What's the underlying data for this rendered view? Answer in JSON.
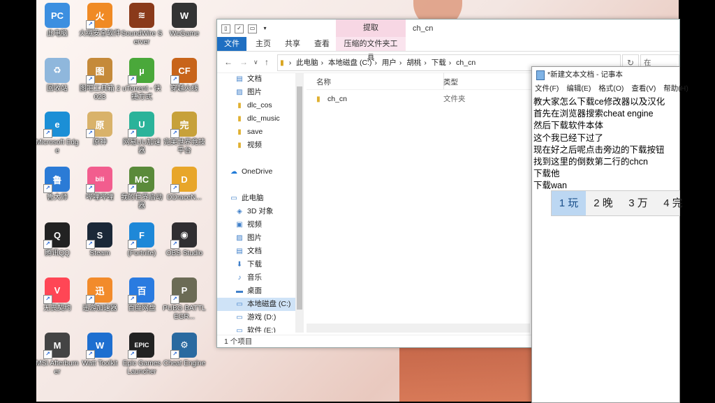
{
  "desktop": {
    "col1": [
      {
        "label": "此电脑",
        "color": "#3c8fe0",
        "glyph": "PC",
        "shortcut": false
      },
      {
        "label": "回收站",
        "color": "#8fb7dc",
        "glyph": "♻",
        "shortcut": false
      },
      {
        "label": "Microsoft Edge",
        "color": "#1b8fd6",
        "glyph": "e",
        "shortcut": true
      },
      {
        "label": "鲁大师",
        "color": "#2b7bd6",
        "glyph": "鲁",
        "shortcut": true
      },
      {
        "label": "腾讯QQ",
        "color": "#222",
        "glyph": "Q",
        "shortcut": true
      },
      {
        "label": "无畏契约",
        "color": "#ff4655",
        "glyph": "V",
        "shortcut": true
      },
      {
        "label": "MSI Afterburner",
        "color": "#444",
        "glyph": "M",
        "shortcut": true
      }
    ],
    "col2": [
      {
        "label": "火绒安全软件",
        "color": "#f08a24",
        "glyph": "火",
        "shortcut": true
      },
      {
        "label": "图吧工具箱 2023",
        "color": "#c58a3a",
        "glyph": "图",
        "shortcut": true
      },
      {
        "label": "原神",
        "color": "#d9b26a",
        "glyph": "原",
        "shortcut": true
      },
      {
        "label": "哔哩哔哩",
        "color": "#f25d8e",
        "glyph": "bili",
        "shortcut": true
      },
      {
        "label": "Steam",
        "color": "#1b2838",
        "glyph": "S",
        "shortcut": true
      },
      {
        "label": "迅游加速器",
        "color": "#f28b2b",
        "glyph": "迅",
        "shortcut": true
      },
      {
        "label": "Watt Toolkit",
        "color": "#1e6fd0",
        "glyph": "W",
        "shortcut": true
      }
    ],
    "col3": [
      {
        "label": "SoundWire Server",
        "color": "#8a3a1a",
        "glyph": "≋",
        "shortcut": false
      },
      {
        "label": "uTorrent - 快捷方式",
        "color": "#4aa83a",
        "glyph": "µ",
        "shortcut": true
      },
      {
        "label": "网易UU加速器",
        "color": "#2bb39a",
        "glyph": "U",
        "shortcut": true
      },
      {
        "label": "我的世界启动器",
        "color": "#5a8a3a",
        "glyph": "MC",
        "shortcut": true
      },
      {
        "label": "(Fortnite)",
        "color": "#1e88d8",
        "glyph": "F",
        "shortcut": true
      },
      {
        "label": "百度网盘",
        "color": "#2a7be0",
        "glyph": "百",
        "shortcut": true
      },
      {
        "label": "Epic Games Launcher",
        "color": "#222",
        "glyph": "EPIC",
        "shortcut": true
      }
    ],
    "col4": [
      {
        "label": "WeGame",
        "color": "#333",
        "glyph": "W",
        "shortcut": false
      },
      {
        "label": "穿越火线",
        "color": "#c8641a",
        "glyph": "CF",
        "shortcut": true
      },
      {
        "label": "完美世界竞技平台",
        "color": "#c7a13a",
        "glyph": "完",
        "shortcut": true
      },
      {
        "label": "DDraceN...",
        "color": "#e8a62a",
        "glyph": "D",
        "shortcut": true
      },
      {
        "label": "OBS Studio",
        "color": "#302e31",
        "glyph": "◉",
        "shortcut": true
      },
      {
        "label": "PUBG BATTLEGR...",
        "color": "#6b6b55",
        "glyph": "P",
        "shortcut": true
      },
      {
        "label": "Cheat Engine",
        "color": "#2a6aa0",
        "glyph": "⚙",
        "shortcut": true
      }
    ]
  },
  "explorer": {
    "ctx_tab_header": "提取",
    "window_title": "ch_cn",
    "tabs": [
      "文件",
      "主页",
      "共享",
      "查看"
    ],
    "ctx_tab": "压缩的文件夹工具",
    "breadcrumb": [
      "此电脑",
      "本地磁盘 (C:)",
      "用户",
      "胡桃",
      "下载",
      "ch_cn"
    ],
    "search_placeholder": "在",
    "nav_items": [
      {
        "label": "文档",
        "icon": "doc-icon",
        "glyph": "▤",
        "pin": true,
        "selected": false
      },
      {
        "label": "图片",
        "icon": "image-icon",
        "glyph": "▨",
        "pin": true,
        "selected": false
      },
      {
        "label": "dlc_cos",
        "icon": "folder-icon",
        "glyph": "▮",
        "pin": false,
        "selected": false
      },
      {
        "label": "dlc_music",
        "icon": "folder-icon",
        "glyph": "▮",
        "pin": false,
        "selected": false
      },
      {
        "label": "save",
        "icon": "folder-icon",
        "glyph": "▮",
        "pin": false,
        "selected": false
      },
      {
        "label": "视频",
        "icon": "folder-icon",
        "glyph": "▮",
        "pin": false,
        "selected": false
      },
      {
        "label": "",
        "icon": "",
        "glyph": "",
        "pin": false,
        "selected": false
      },
      {
        "label": "OneDrive",
        "icon": "cloud-icon",
        "glyph": "☁",
        "pin": false,
        "selected": false
      },
      {
        "label": "",
        "icon": "",
        "glyph": "",
        "pin": false,
        "selected": false
      },
      {
        "label": "此电脑",
        "icon": "pc-icon",
        "glyph": "▭",
        "pin": false,
        "selected": false
      },
      {
        "label": "3D 对象",
        "icon": "cube-icon",
        "glyph": "◈",
        "pin": false,
        "selected": false
      },
      {
        "label": "视频",
        "icon": "video-icon",
        "glyph": "▣",
        "pin": false,
        "selected": false
      },
      {
        "label": "图片",
        "icon": "image-icon",
        "glyph": "▨",
        "pin": false,
        "selected": false
      },
      {
        "label": "文档",
        "icon": "doc-icon",
        "glyph": "▤",
        "pin": false,
        "selected": false
      },
      {
        "label": "下载",
        "icon": "download-icon",
        "glyph": "⬇",
        "pin": false,
        "selected": false
      },
      {
        "label": "音乐",
        "icon": "music-icon",
        "glyph": "♪",
        "pin": false,
        "selected": false
      },
      {
        "label": "桌面",
        "icon": "desktop-icon",
        "glyph": "▬",
        "pin": false,
        "selected": false
      },
      {
        "label": "本地磁盘 (C:)",
        "icon": "drive-icon",
        "glyph": "▭",
        "pin": false,
        "selected": true
      },
      {
        "label": "游戏 (D:)",
        "icon": "drive-icon",
        "glyph": "▭",
        "pin": false,
        "selected": false
      },
      {
        "label": "软件 (E:)",
        "icon": "drive-icon",
        "glyph": "▭",
        "pin": false,
        "selected": false
      }
    ],
    "columns": {
      "name": "名称",
      "type": "类型"
    },
    "files": [
      {
        "name": "ch_cn",
        "type": "文件夹"
      }
    ],
    "status": "1 个项目"
  },
  "notepad": {
    "title": "*新建文本文档 - 记事本",
    "menu": [
      "文件(F)",
      "编辑(E)",
      "格式(O)",
      "查看(V)",
      "帮助(H)"
    ],
    "lines": [
      "教大家怎么下载ce修改器以及汉化",
      "首先在浏览器搜索cheat engine",
      "然后下载软件本体",
      "这个我已经下过了",
      "现在好之后呢点击旁边的下载按钮",
      "找到这里的倒数第二行的chcn",
      "下载他",
      "下载wan"
    ]
  },
  "ime": {
    "candidates": [
      "1 玩",
      "2 晚",
      "3 万",
      "4 完"
    ],
    "selected_index": 0
  }
}
